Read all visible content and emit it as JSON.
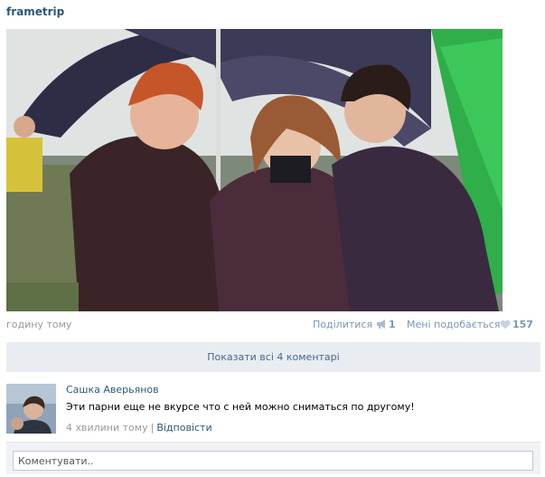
{
  "post": {
    "author": "frametrip",
    "time": "годину тому",
    "share_label": "Поділитися",
    "share_count": "1",
    "like_label": "Мені подобається",
    "like_count": "157"
  },
  "comments": {
    "show_all_label": "Показати всі 4 коментарі",
    "items": [
      {
        "author": "Сашка Аверьянов",
        "text": "Эти парни еще не вкурсе что с ней можно сниматься по другому!",
        "time": "4 хвилини тому",
        "separator": "|",
        "reply_label": "Відповісти"
      }
    ]
  },
  "comment_box": {
    "placeholder": "Коментувати.."
  },
  "icons": {
    "share": "megaphone-icon",
    "like": "heart-icon"
  },
  "colors": {
    "link": "#2b587a",
    "muted_link": "#7996b5",
    "muted_text": "#999999",
    "bar_bg": "#e9edf1"
  }
}
